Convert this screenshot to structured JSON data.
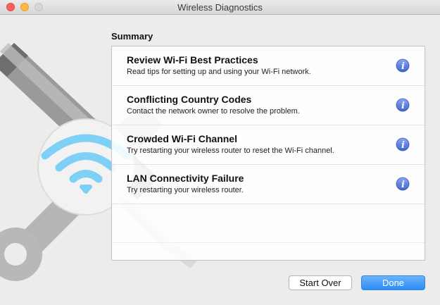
{
  "window": {
    "title": "Wireless Diagnostics"
  },
  "summary": {
    "heading": "Summary",
    "items": [
      {
        "title": "Review Wi-Fi Best Practices",
        "description": "Read tips for setting up and using your Wi-Fi network.",
        "icon": "info-icon"
      },
      {
        "title": "Conflicting Country Codes",
        "description": "Contact the network owner to resolve the problem.",
        "icon": "info-icon"
      },
      {
        "title": "Crowded Wi-Fi Channel",
        "description": "Try restarting your wireless router to reset the Wi-Fi channel.",
        "icon": "info-icon"
      },
      {
        "title": "LAN Connectivity Failure",
        "description": "Try restarting your wireless router.",
        "icon": "info-icon"
      }
    ]
  },
  "buttons": {
    "start_over": "Start Over",
    "done": "Done"
  },
  "colors": {
    "accent": "#2c8cf5",
    "info_icon": "#4f78d6",
    "wifi_icon": "#7fd0f6",
    "close": "#fc605b",
    "minimize": "#fdbc40"
  }
}
